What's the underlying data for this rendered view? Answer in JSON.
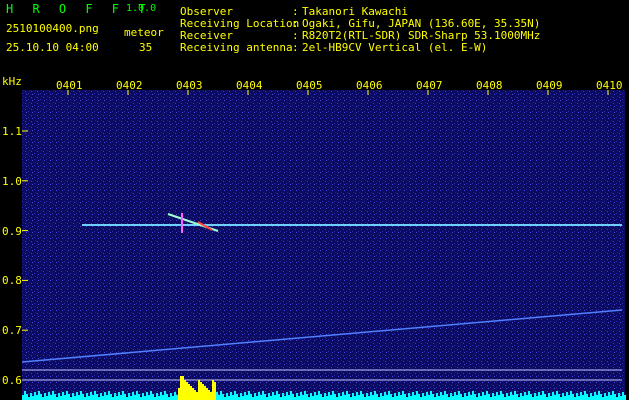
{
  "header": {
    "brand": "H R O F F T",
    "version": "1.0.0",
    "filename": "2510100400.png",
    "datetime": "25.10.10 04:00",
    "meteor_label": "meteor",
    "meteor_count": "35"
  },
  "station": {
    "observer_label": "Observer",
    "observer_value": "Takanori Kawachi",
    "location_label": "Receiving Location",
    "location_value": "Ogaki, Gifu, JAPAN (136.60E, 35.35N)",
    "receiver_label": "Receiver",
    "receiver_value": "R820T2(RTL-SDR) SDR-Sharp 53.1000MHz",
    "antenna_label": "Receiving antenna",
    "antenna_value": "2el-HB9CV Vertical (el. E-W)"
  },
  "axis": {
    "y_unit": "kHz",
    "time_ticks": [
      "0401",
      "0402",
      "0403",
      "0404",
      "0405",
      "0406",
      "0407",
      "0408",
      "0409",
      "0410"
    ],
    "freq_ticks": [
      "1.1",
      "1.0",
      "0.9",
      "0.8",
      "0.7",
      "0.6"
    ]
  },
  "colors": {
    "text_green": "#00ff00",
    "text_white": "#ffffff",
    "text_yellow": "#ffff00",
    "spectrogram_bg": "#0a0a6a",
    "signal": "#6fd0ff",
    "histogram": "#00ffff"
  }
}
